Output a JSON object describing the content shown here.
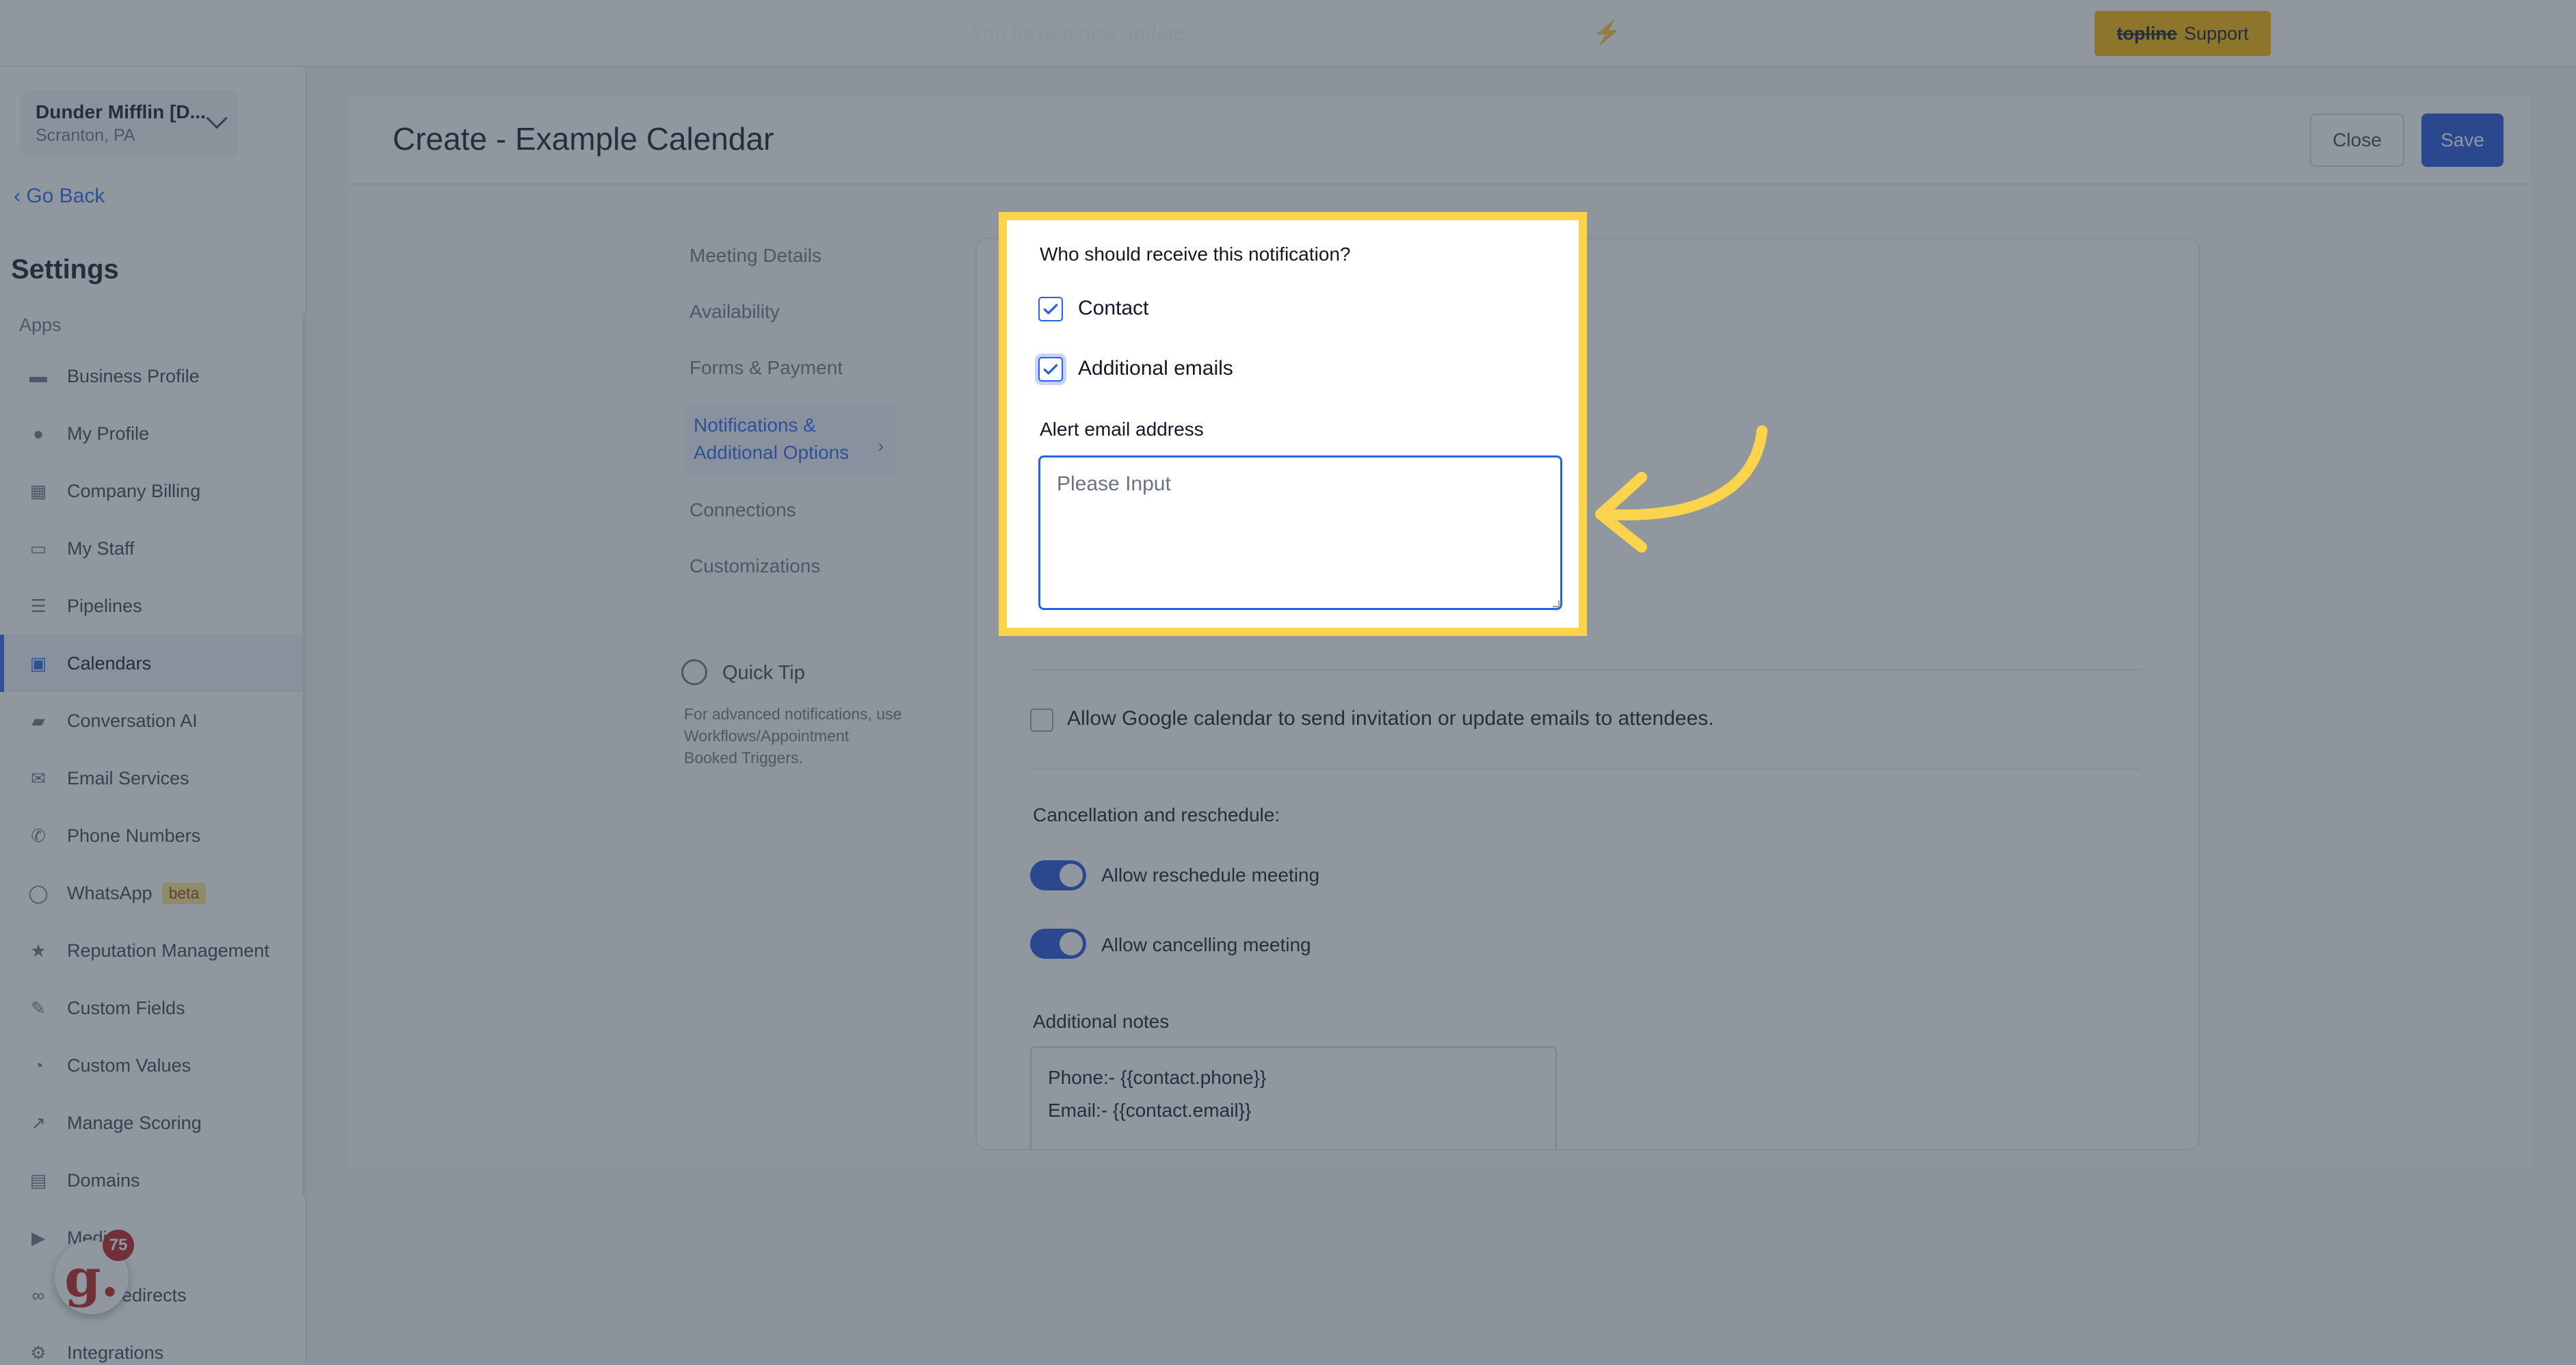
{
  "topbar": {
    "ghost_text": "You have a new update",
    "support_brand": "topline",
    "support_label": "Support"
  },
  "sidebar": {
    "location_name": "Dunder Mifflin [D...",
    "location_sub": "Scranton, PA",
    "go_back": "Go Back",
    "settings_title": "Settings",
    "apps_label": "Apps",
    "items": [
      {
        "label": "Business Profile",
        "icon": "briefcase-icon"
      },
      {
        "label": "My Profile",
        "icon": "user-icon"
      },
      {
        "label": "Company Billing",
        "icon": "grid-icon"
      },
      {
        "label": "My Staff",
        "icon": "staff-icon"
      },
      {
        "label": "Pipelines",
        "icon": "filter-icon"
      },
      {
        "label": "Calendars",
        "icon": "calendar-icon"
      },
      {
        "label": "Conversation AI",
        "icon": "chat-icon"
      },
      {
        "label": "Email Services",
        "icon": "email-icon"
      },
      {
        "label": "Phone Numbers",
        "icon": "phone-icon"
      },
      {
        "label": "WhatsApp",
        "icon": "whatsapp-icon",
        "badge": "beta"
      },
      {
        "label": "Reputation Management",
        "icon": "star-icon"
      },
      {
        "label": "Custom Fields",
        "icon": "custom-fields-icon"
      },
      {
        "label": "Custom Values",
        "icon": "pie-icon"
      },
      {
        "label": "Manage Scoring",
        "icon": "chart-icon"
      },
      {
        "label": "Domains",
        "icon": "domains-icon"
      },
      {
        "label": "Media",
        "icon": "video-icon"
      },
      {
        "label": "URL Redirects",
        "icon": "link-icon"
      },
      {
        "label": "Integrations",
        "icon": "integrations-icon"
      }
    ],
    "active_index": 5,
    "avatar_letter": "g.",
    "avatar_badge": "75"
  },
  "header": {
    "title": "Create - Example Calendar",
    "close_label": "Close",
    "save_label": "Save"
  },
  "subnav": {
    "items": [
      "Meeting Details",
      "Availability",
      "Forms & Payment",
      "Notifications & Additional Options",
      "Connections",
      "Customizations"
    ],
    "active_label_line1": "Notifications &",
    "active_label_line2": "Additional Options",
    "tip_title": "Quick Tip",
    "tip_body": "For advanced notifications, use Workflows/Appointment Booked Triggers."
  },
  "notification": {
    "question": "Who should receive this notification?",
    "contact_label": "Contact",
    "contact_checked": true,
    "additional_label": "Additional emails",
    "additional_checked": true,
    "alert_label": "Alert email address",
    "alert_placeholder": "Please Input",
    "alert_value": ""
  },
  "form": {
    "gcal_label": "Allow Google calendar to send invitation or update emails to attendees.",
    "gcal_checked": false,
    "cancel_title": "Cancellation and reschedule:",
    "reschedule_label": "Allow reschedule meeting",
    "reschedule_on": true,
    "cancelling_label": "Allow cancelling meeting",
    "cancelling_on": true,
    "notes_title": "Additional notes",
    "notes_line1": "Phone:- {{contact.phone}}",
    "notes_line2": "Email:- {{contact.email}}"
  },
  "colors": {
    "accent": "#1d4ed8",
    "highlight": "#fcd34d",
    "support": "#f5b400"
  }
}
